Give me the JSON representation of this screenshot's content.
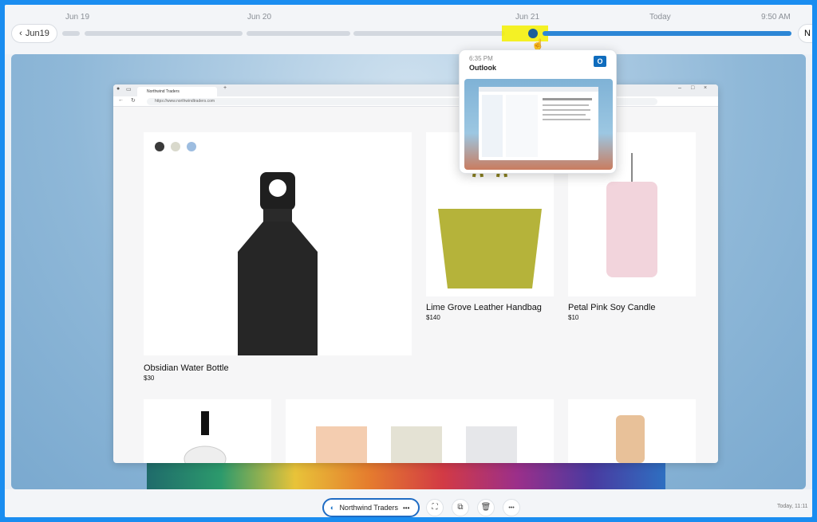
{
  "timeline": {
    "back_label": "Jun19",
    "dates": [
      "Jun 19",
      "Jun 20",
      "Jun 21",
      "Today"
    ],
    "time": "9:50 AM",
    "next_label": "N"
  },
  "popup": {
    "time": "6:35 PM",
    "app": "Outlook"
  },
  "browser": {
    "tab_title": "Northwind Traders",
    "url": "https://www.northwindtraders.com"
  },
  "products": [
    {
      "name": "Obsidian  Water Bottle",
      "price": "$30"
    },
    {
      "name": "Lime Grove Leather Handbag",
      "price": "$140"
    },
    {
      "name": "Petal Pink Soy Candle",
      "price": "$10"
    }
  ],
  "swatches": [
    "#3a3a3a",
    "#d9d9cc",
    "#9dbde0"
  ],
  "bottombar": {
    "pill_label": "Northwind Traders",
    "pill_more": "•••",
    "more_label": "•••",
    "clock": "Today, 11:11"
  },
  "colors": {
    "accent": "#1f6cc4",
    "highlight": "#f3f000"
  }
}
